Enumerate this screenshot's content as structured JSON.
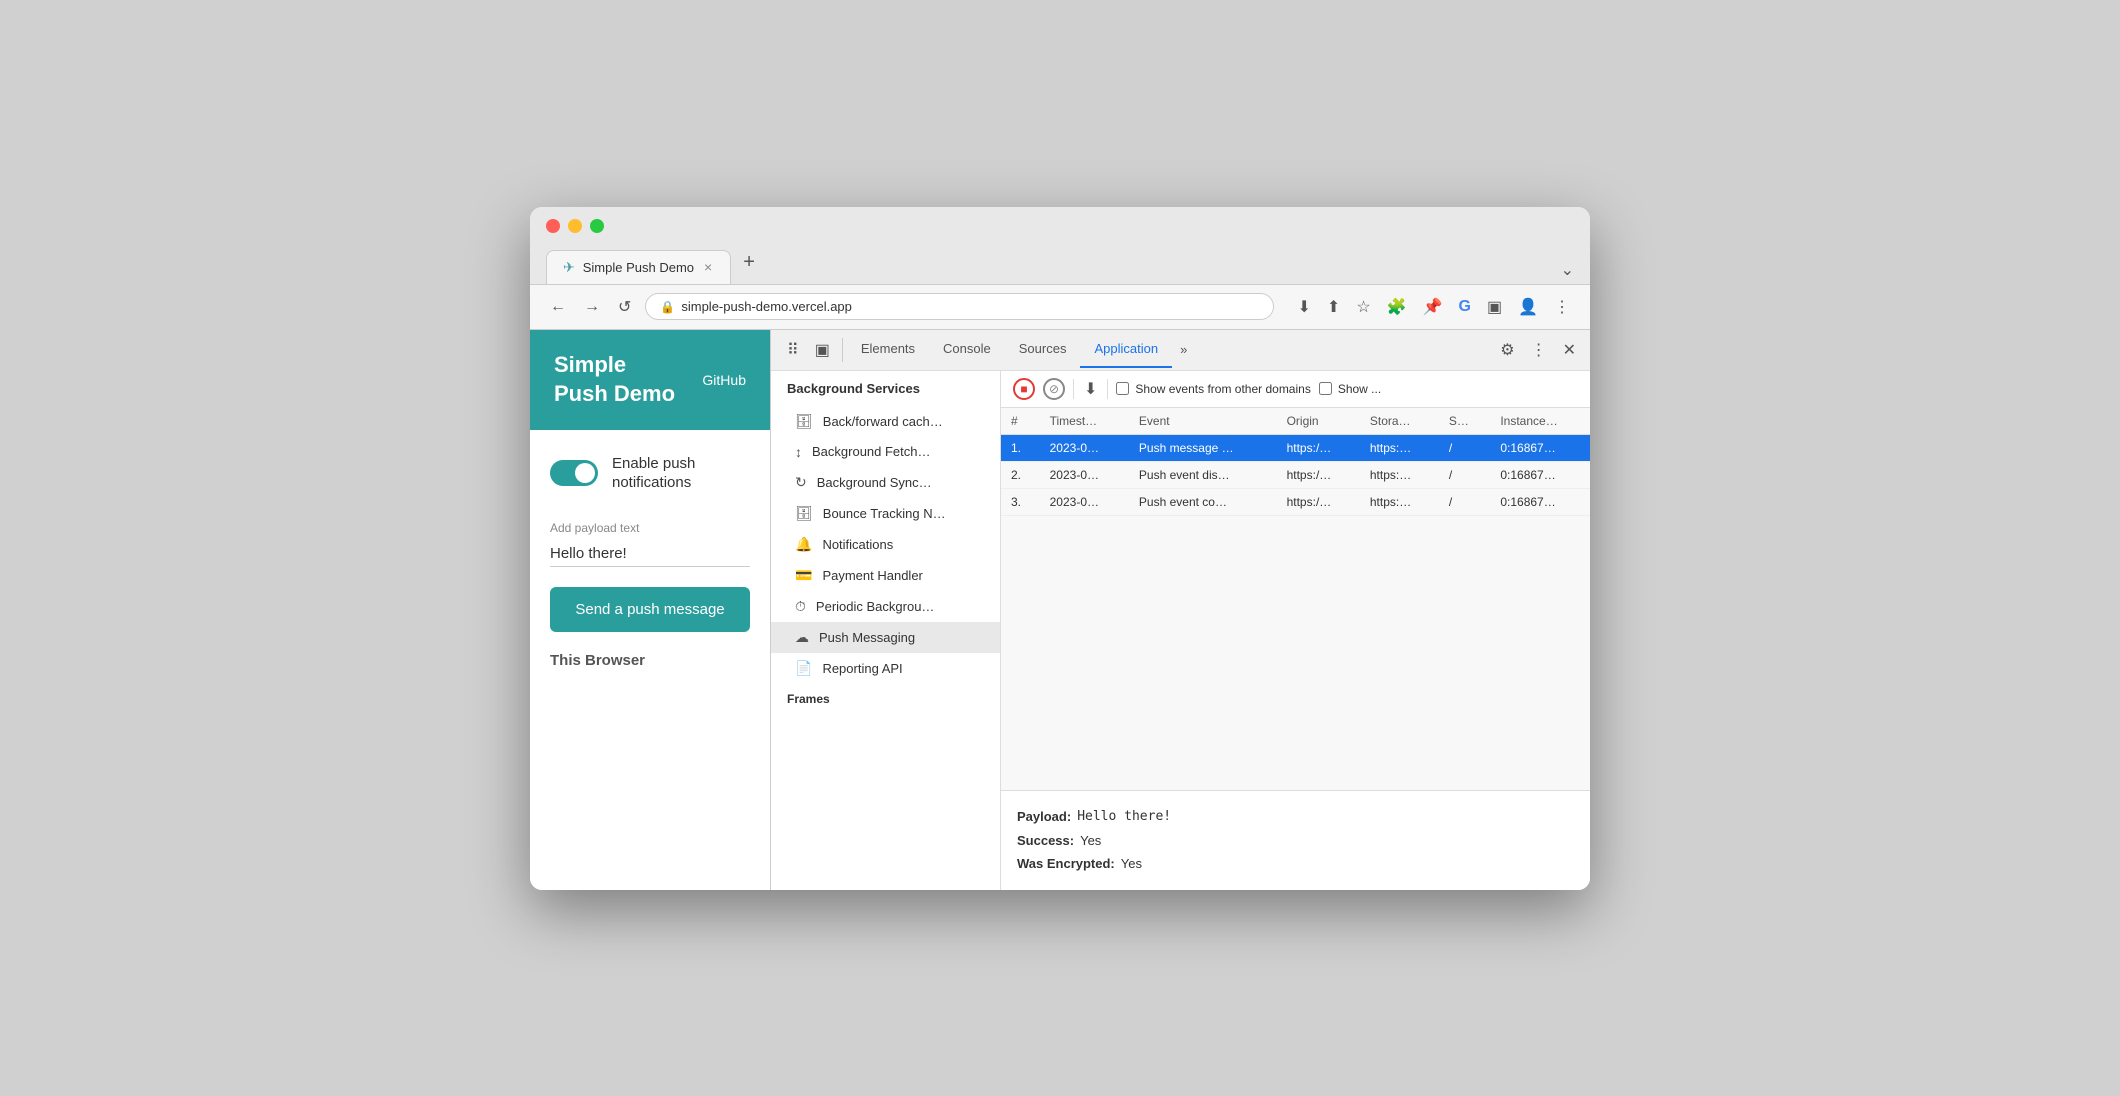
{
  "browser": {
    "tab_title": "Simple Push Demo",
    "tab_close": "×",
    "tab_new": "+",
    "tab_dropdown": "⌄",
    "url": "simple-push-demo.vercel.app",
    "nav": {
      "back": "←",
      "forward": "→",
      "refresh": "↺"
    },
    "toolbar_icons": [
      "download",
      "share",
      "star",
      "puzzle",
      "pin",
      "google",
      "layout",
      "profile",
      "more"
    ]
  },
  "website": {
    "title": "Simple\nPush Demo",
    "github_link": "GitHub",
    "toggle_label": "Enable push\nnotifications",
    "toggle_enabled": true,
    "payload_label": "Add payload text",
    "payload_value": "Hello there!",
    "send_button": "Send a push message",
    "this_browser": "This Browser"
  },
  "devtools": {
    "tabs": [
      "Elements",
      "Console",
      "Sources",
      "Application"
    ],
    "active_tab": "Application",
    "tab_more": "»",
    "toolbar": {
      "record_stop": "■",
      "clear": "⊘",
      "export": "↓",
      "show_other_domains_label": "Show events from other domains",
      "show_label": "Show ..."
    },
    "sidebar": {
      "background_services_title": "Background Services",
      "items": [
        {
          "icon": "🗄",
          "label": "Back/forward cach…"
        },
        {
          "icon": "↕",
          "label": "Background Fetch…"
        },
        {
          "icon": "↻",
          "label": "Background Sync…"
        },
        {
          "icon": "🗄",
          "label": "Bounce Tracking N…"
        },
        {
          "icon": "🔔",
          "label": "Notifications"
        },
        {
          "icon": "💳",
          "label": "Payment Handler"
        },
        {
          "icon": "⏱",
          "label": "Periodic Backgrou…"
        },
        {
          "icon": "☁",
          "label": "Push Messaging"
        },
        {
          "icon": "📄",
          "label": "Reporting API"
        }
      ],
      "active_item_index": 7,
      "frames_title": "Frames"
    },
    "events_table": {
      "columns": [
        "#",
        "Timest…",
        "Event",
        "Origin",
        "Stora…",
        "S…",
        "Instance…"
      ],
      "rows": [
        {
          "num": "1.",
          "timestamp": "2023-0…",
          "event": "Push message …",
          "origin": "https:/…",
          "storage": "https:…",
          "s": "/",
          "instance": "0:16867…",
          "selected": true
        },
        {
          "num": "2.",
          "timestamp": "2023-0…",
          "event": "Push event dis…",
          "origin": "https:/…",
          "storage": "https:…",
          "s": "/",
          "instance": "0:16867…",
          "selected": false
        },
        {
          "num": "3.",
          "timestamp": "2023-0…",
          "event": "Push event co…",
          "origin": "https:/…",
          "storage": "https:…",
          "s": "/",
          "instance": "0:16867…",
          "selected": false
        }
      ]
    },
    "detail": {
      "payload_key": "Payload:",
      "payload_val": "Hello there!",
      "success_key": "Success:",
      "success_val": "Yes",
      "encrypted_key": "Was Encrypted:",
      "encrypted_val": "Yes"
    }
  },
  "colors": {
    "teal": "#2a9d9d",
    "selected_blue": "#1a73e8"
  }
}
